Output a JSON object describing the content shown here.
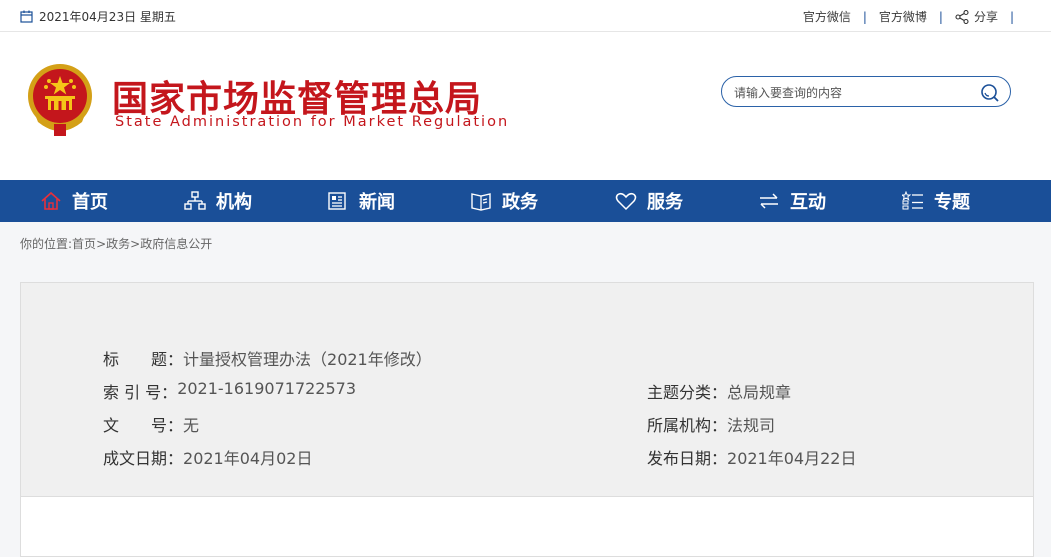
{
  "topbar": {
    "date": "2021年04月23日 星期五",
    "links": [
      "官方微信",
      "官方微博"
    ],
    "separator": "|",
    "share_label": "分享"
  },
  "header": {
    "title_cn": "国家市场监督管理总局",
    "title_en": "State Administration for Market Regulation"
  },
  "search": {
    "placeholder": "请输入要查询的内容"
  },
  "nav": {
    "items": [
      {
        "label": "首页",
        "icon": "home-icon"
      },
      {
        "label": "机构",
        "icon": "org-icon"
      },
      {
        "label": "新闻",
        "icon": "news-icon"
      },
      {
        "label": "政务",
        "icon": "affairs-icon"
      },
      {
        "label": "服务",
        "icon": "heart-icon"
      },
      {
        "label": "互动",
        "icon": "exchange-icon"
      },
      {
        "label": "专题",
        "icon": "topic-icon"
      }
    ]
  },
  "breadcrumb": {
    "prefix": "你的位置:",
    "items": [
      "首页",
      "政务",
      "政府信息公开"
    ],
    "sep": ">"
  },
  "info": {
    "title_label": "标　　题：",
    "title_value": "计量授权管理办法（2021年修改）",
    "index_label": "索 引 号：",
    "index_value": "2021-1619071722573",
    "docno_label": "文　　号：",
    "docno_value": "无",
    "date_label": "成文日期：",
    "date_value": "2021年04月02日",
    "topic_label": "主题分类：",
    "topic_value": "总局规章",
    "org_label": "所属机构：",
    "org_value": "法规司",
    "pub_label": "发布日期：",
    "pub_value": "2021年04月22日"
  },
  "colors": {
    "brand_red": "#c4161c",
    "nav_blue": "#1a4f98"
  }
}
